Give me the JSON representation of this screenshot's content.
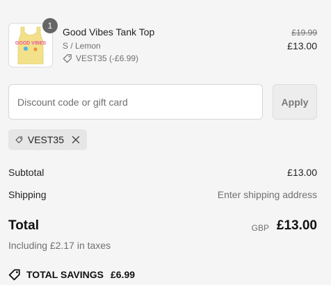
{
  "line_item": {
    "quantity": "1",
    "title": "Good Vibes Tank Top",
    "variant": "S / Lemon",
    "discount": "VEST35 (-£6.99)",
    "compare_price": "£19.99",
    "price": "£13.00",
    "image_text": "GOOD VIBES",
    "product_color": "#f2e08a"
  },
  "discount_form": {
    "placeholder": "Discount code or gift card",
    "apply_label": "Apply"
  },
  "applied_code": "VEST35",
  "summary": {
    "subtotal_label": "Subtotal",
    "subtotal_value": "£13.00",
    "shipping_label": "Shipping",
    "shipping_value": "Enter shipping address",
    "total_label": "Total",
    "currency": "GBP",
    "total_value": "£13.00",
    "taxes_note": "Including £2.17 in taxes"
  },
  "savings": {
    "label": "TOTAL SAVINGS",
    "amount": "£6.99"
  }
}
